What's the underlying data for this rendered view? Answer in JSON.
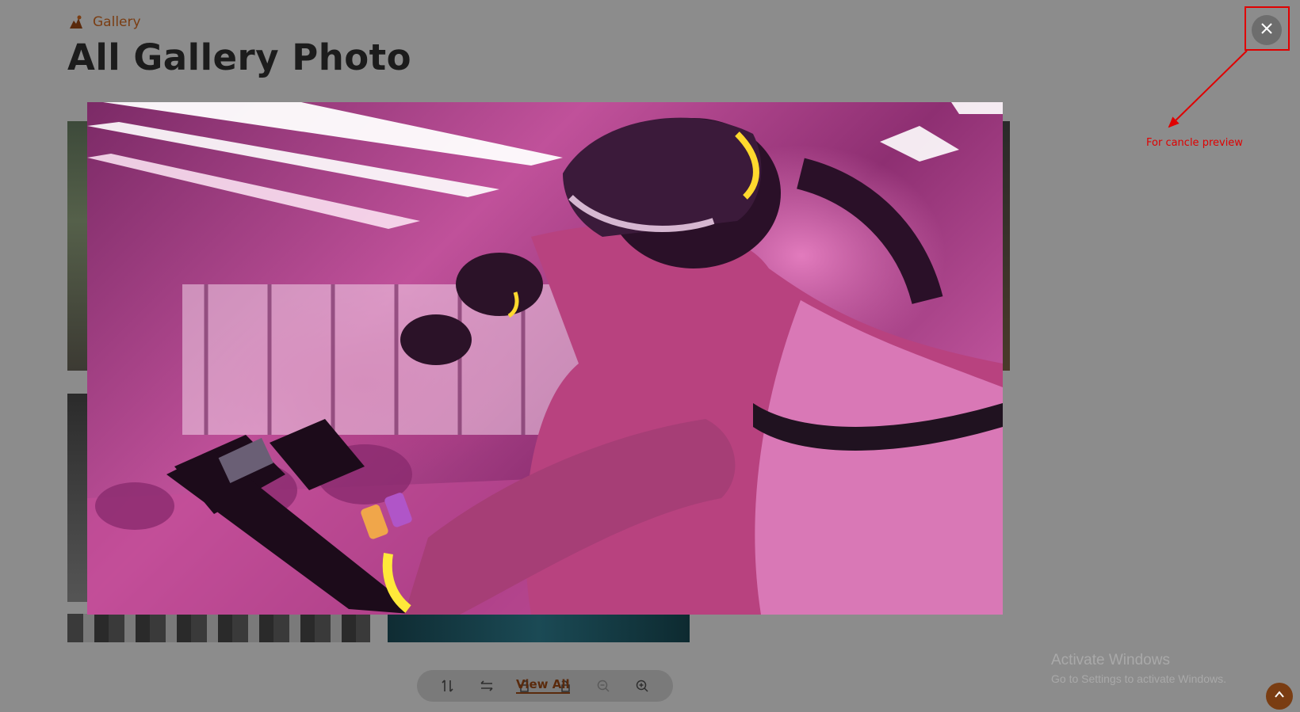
{
  "breadcrumb": {
    "label": "Gallery",
    "icon": "gallery-logo-icon"
  },
  "page": {
    "title": "All Gallery Photo"
  },
  "preview": {
    "close_icon": "close-icon"
  },
  "annotation": {
    "text": "For cancle preview",
    "color": "#e00000"
  },
  "toolbar": {
    "tools": [
      {
        "name": "flip-vertical-icon"
      },
      {
        "name": "flip-horizontal-icon"
      },
      {
        "name": "rotate-left-icon"
      },
      {
        "name": "rotate-right-icon"
      },
      {
        "name": "zoom-out-icon"
      },
      {
        "name": "zoom-in-icon"
      }
    ],
    "view_all_label": "View All"
  },
  "watermark": {
    "title": "Activate Windows",
    "subtitle": "Go to Settings to activate Windows."
  },
  "colors": {
    "brand": "#7a3d12",
    "overlay": "#8c8c8c"
  }
}
